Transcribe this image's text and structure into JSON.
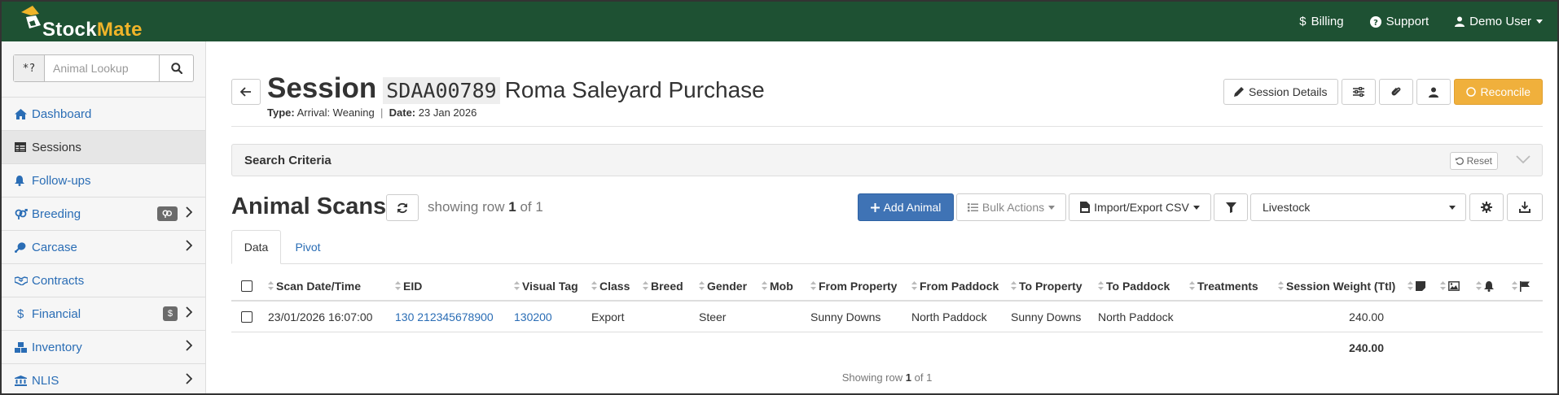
{
  "brand": {
    "name_part1": "Stock",
    "name_part2": "Mate"
  },
  "topnav": {
    "billing": "Billing",
    "support": "Support",
    "user": "Demo User"
  },
  "lookup": {
    "prefix": "*?",
    "placeholder": "Animal Lookup"
  },
  "sidebar": {
    "items": [
      {
        "label": "Dashboard"
      },
      {
        "label": "Sessions"
      },
      {
        "label": "Follow-ups"
      },
      {
        "label": "Breeding"
      },
      {
        "label": "Carcase"
      },
      {
        "label": "Contracts"
      },
      {
        "label": "Financial",
        "badge": "$"
      },
      {
        "label": "Inventory"
      },
      {
        "label": "NLIS"
      }
    ]
  },
  "session": {
    "title": "Session",
    "code": "SDAA00789",
    "name": "Roma Saleyard Purchase",
    "type_label": "Type:",
    "type_value": "Arrival: Weaning",
    "date_label": "Date:",
    "date_value": "23 Jan 2026",
    "separator": "|"
  },
  "toolbar": {
    "session_details": "Session Details",
    "reconcile": "Reconcile"
  },
  "criteria": {
    "label": "Search Criteria",
    "reset": "Reset"
  },
  "scans": {
    "title": "Animal Scans",
    "showing_prefix": "showing row",
    "showing_row": "1",
    "showing_of": "of 1",
    "add_animal": "Add Animal",
    "bulk_actions": "Bulk Actions",
    "import_export": "Import/Export CSV",
    "view_select": "Livestock"
  },
  "tabs": {
    "data": "Data",
    "pivot": "Pivot"
  },
  "table": {
    "headers": {
      "scan_date": "Scan Date/Time",
      "eid": "EID",
      "visual_tag": "Visual Tag",
      "class": "Class",
      "breed": "Breed",
      "gender": "Gender",
      "mob": "Mob",
      "from_property": "From Property",
      "from_paddock": "From Paddock",
      "to_property": "To Property",
      "to_paddock": "To Paddock",
      "treatments": "Treatments",
      "session_weight": "Session Weight (Ttl)"
    },
    "rows": [
      {
        "scan_date": "23/01/2026 16:07:00",
        "eid": "130 212345678900",
        "visual_tag": "130200",
        "class": "Export",
        "breed": "",
        "gender": "Steer",
        "mob": "",
        "from_property": "Sunny Downs",
        "from_paddock": "North Paddock",
        "to_property": "Sunny Downs",
        "to_paddock": "North Paddock",
        "treatments": "",
        "session_weight": "240.00"
      }
    ],
    "total_weight": "240.00"
  },
  "footer": {
    "prefix": "Showing row",
    "row": "1",
    "suffix": "of 1"
  }
}
